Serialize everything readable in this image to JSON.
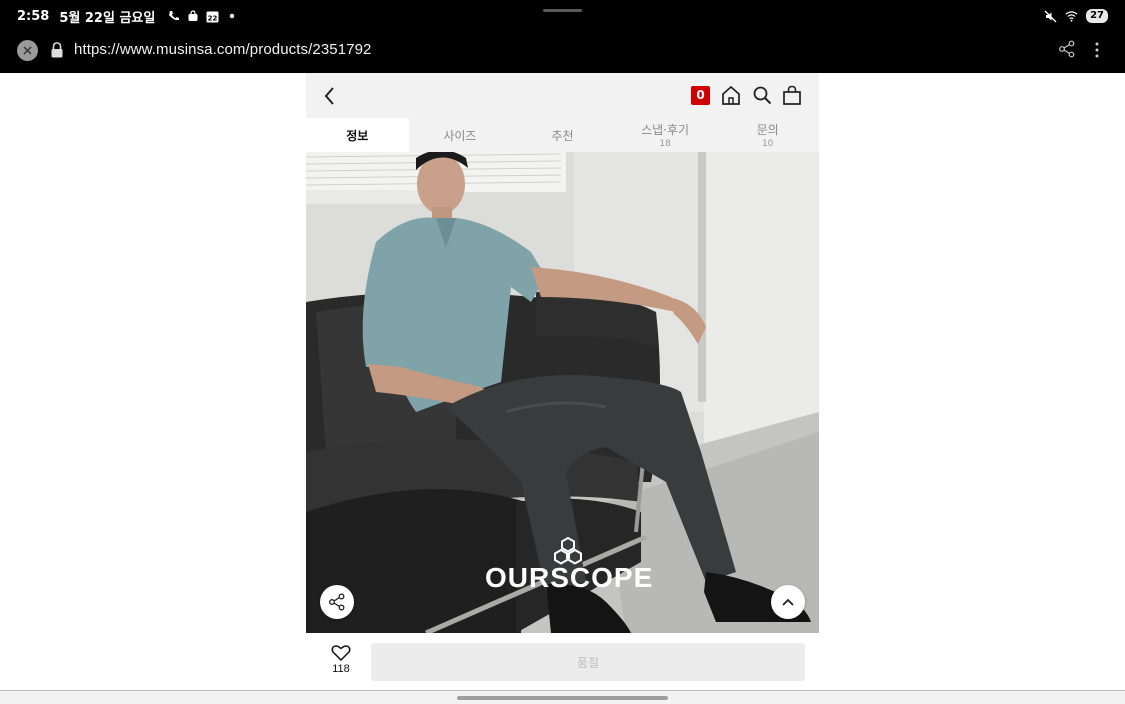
{
  "status_bar": {
    "time": "2:58",
    "date": "5월 22일 금요일",
    "calendar_day": "22",
    "battery": "27"
  },
  "browser": {
    "url": "https://www.musinsa.com/products/2351792"
  },
  "header": {
    "cart_count": "0"
  },
  "tabs": [
    {
      "label": "정보",
      "count": ""
    },
    {
      "label": "사이즈",
      "count": ""
    },
    {
      "label": "추천",
      "count": ""
    },
    {
      "label": "스냅·후기",
      "count": "18"
    },
    {
      "label": "문의",
      "count": "10"
    }
  ],
  "hero": {
    "brand": "OURSCOPE"
  },
  "bottom": {
    "likes": "118",
    "buy_button": "품절"
  },
  "colors": {
    "accent_red": "#d10000",
    "nav_bg": "#f2f2f2"
  }
}
